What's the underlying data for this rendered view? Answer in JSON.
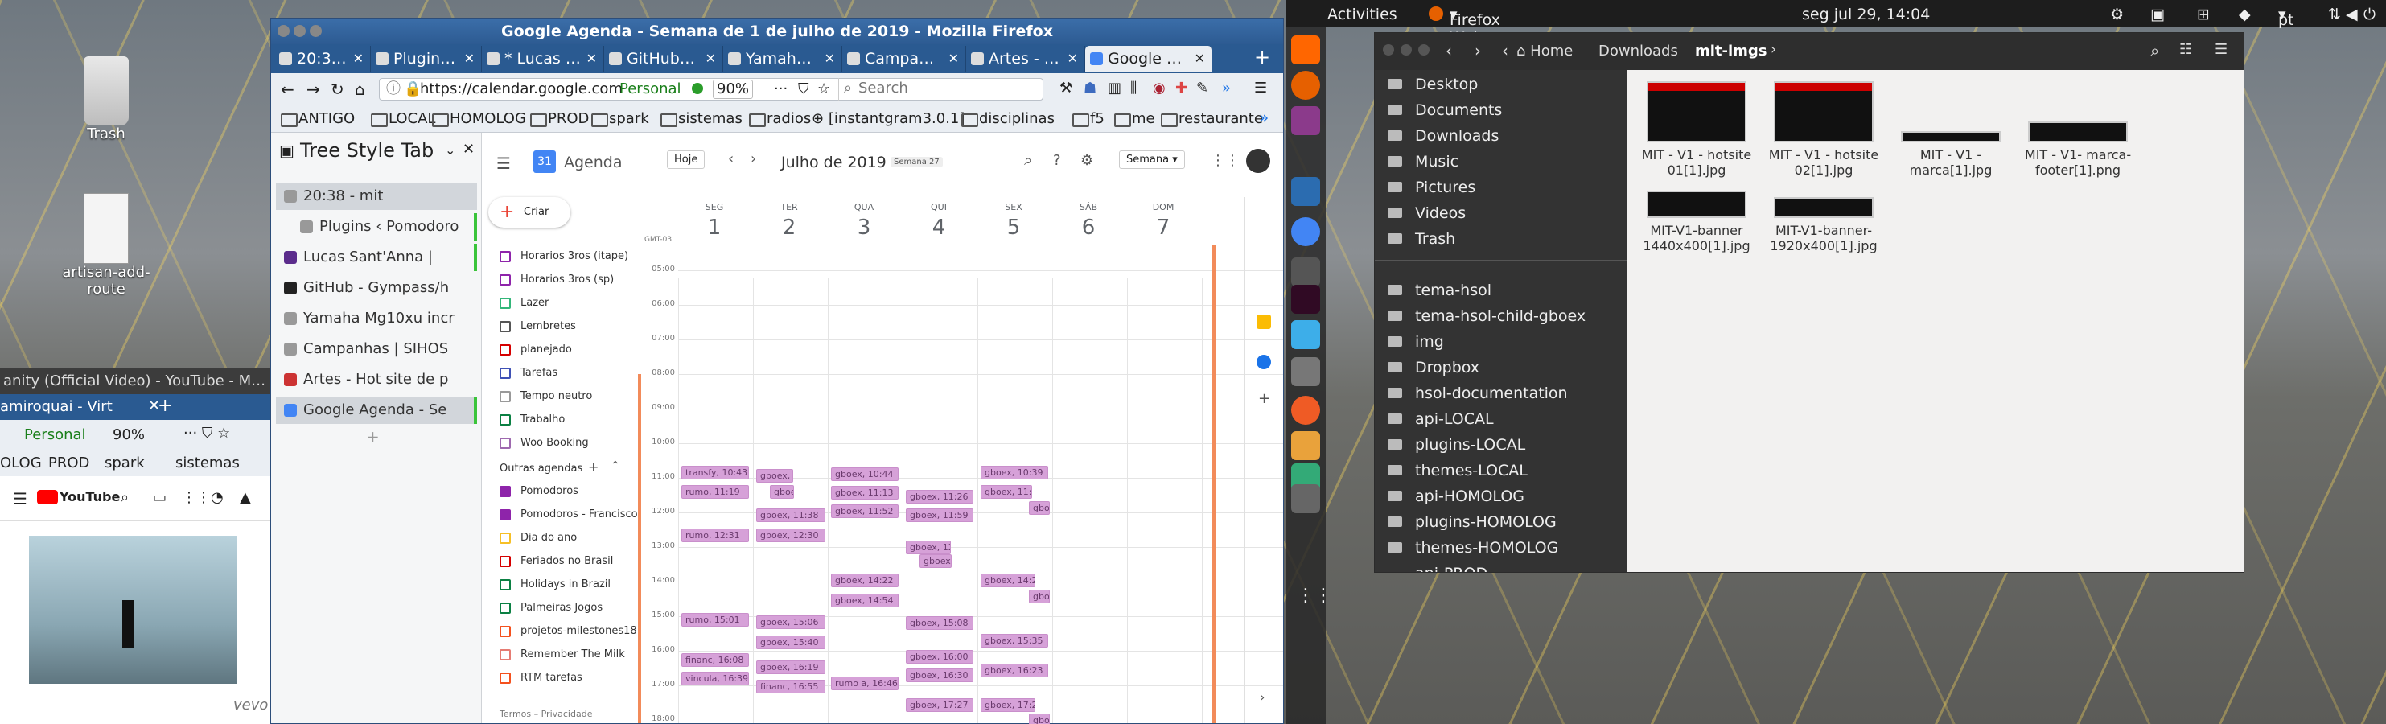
{
  "topbar": {
    "activities": "Activities",
    "app_menu": "Firefox Web Browser",
    "clock": "seg jul 29, 14:04",
    "lang": "pt"
  },
  "desktop": {
    "trash": "Trash",
    "file": "artisan-add-route"
  },
  "firefox": {
    "title": "Google Agenda - Semana de 1 de julho de 2019 - Mozilla Firefox",
    "tabs": [
      "20:38 - mit",
      "Plugins ‹ P",
      "* Lucas Sant",
      "GitHub - G",
      "Yamaha M",
      "Campanha",
      "Artes - Ho",
      "Google Ag"
    ],
    "url": "https://calendar.google.com",
    "identity": "Personal",
    "zoom": "90%",
    "search_placeholder": "Search",
    "bookmarks": [
      "ANTIGO",
      "LOCAL",
      "HOMOLOG",
      "PROD",
      "spark",
      "sistemas",
      "radios",
      "[instantgram3.0.1]",
      "disciplinas",
      "f5",
      "me",
      "restaurante"
    ],
    "sidebar": {
      "title": "Tree Style Tab",
      "tabs": [
        "20:38 - mit",
        "Plugins ‹ Pomodoro",
        "Lucas Sant'Anna |",
        "GitHub - Gympass/h",
        "Yamaha Mg10xu incr",
        "Campanhas | SIHOS",
        "Artes - Hot site de p",
        "Google Agenda - Se"
      ]
    },
    "calendar": {
      "app": "Agenda",
      "today": "Hoje",
      "month": "Julho de 2019",
      "week_badge": "Semana 27",
      "view": "Semana",
      "create": "Criar",
      "gmt": "GMT-03",
      "days": [
        {
          "n": "SEG",
          "d": "1"
        },
        {
          "n": "TER",
          "d": "2"
        },
        {
          "n": "QUA",
          "d": "3"
        },
        {
          "n": "QUI",
          "d": "4"
        },
        {
          "n": "SEX",
          "d": "5"
        },
        {
          "n": "SÁB",
          "d": "6"
        },
        {
          "n": "DOM",
          "d": "7"
        }
      ],
      "hours": [
        "05:00",
        "06:00",
        "07:00",
        "08:00",
        "09:00",
        "10:00",
        "11:00",
        "12:00",
        "13:00",
        "14:00",
        "15:00",
        "16:00",
        "17:00",
        "18:00"
      ],
      "my_cals": [
        "Horarios 3ros (itape)",
        "Horarios 3ros (sp)",
        "Lazer",
        "Lembretes",
        "planejado",
        "Tarefas",
        "Tempo neutro",
        "Trabalho",
        "Woo Booking"
      ],
      "other_title": "Outras agendas",
      "other_cals": [
        "Pomodoros",
        "Pomodoros - Francisco",
        "Dia do ano",
        "Feriados no Brasil",
        "Holidays in Brazil",
        "Palmeiras Jogos",
        "projetos-milestones18",
        "Remember The Milk",
        "RTM tarefas"
      ],
      "footer": "Termos – Privacidade",
      "events": [
        "transfy, 10:43",
        "rumo, 11:19",
        "gboex, 10:4",
        "gboex",
        "gboex, 11:38",
        "gboex, 12:30",
        "gboex, 10:44",
        "gboex, 11:13",
        "gboex, 11:52",
        "gboex, 11:26",
        "gboex, 11:59",
        "gboex, 10:39",
        "gboex, 11:1",
        "gboex",
        "rumo, 12:31",
        "gboex, 12:5",
        "gboex",
        "gboex, 14:22",
        "gboex, 14:54",
        "gboex, 14:2",
        "gboex",
        "rumo, 15:01",
        "gboex, 15:06",
        "gboex, 15:40",
        "gboex, 15:08",
        "gboex, 15:35",
        "financ, 16:08",
        "gboex, 16:19",
        "gboex, 16:00",
        "gboex, 16:23",
        "vincula, 16:39",
        "financ, 16:55",
        "rumo a, 16:46",
        "gboex, 16:30",
        "gboex, 17:27",
        "gboex, 17:2",
        "gboex"
      ]
    }
  },
  "files": {
    "home": "Home",
    "crumbs": [
      "Downloads",
      "mit-imgs"
    ],
    "places": [
      "Desktop",
      "Documents",
      "Downloads",
      "Music",
      "Pictures",
      "Videos",
      "Trash"
    ],
    "bookmarks": [
      "tema-hsol",
      "tema-hsol-child-gboex",
      "img",
      "Dropbox",
      "hsol-documentation",
      "api-LOCAL",
      "plugins-LOCAL",
      "themes-LOCAL",
      "api-HOMOLOG",
      "plugins-HOMOLOG",
      "themes-HOMOLOG",
      "api-PROD"
    ],
    "items": [
      "MIT - V1 - hotsite 01[1].jpg",
      "MIT - V1 - hotsite 02[1].jpg",
      "MIT - V1 - marca[1].jpg",
      "MIT - V1- marca-footer[1].png",
      "MIT-V1-banner 1440x400[1].jpg",
      "MIT-V1-banner-1920x400[1].jpg"
    ]
  },
  "ff2": {
    "title": "anity (Official Video) - YouTube - Mozil",
    "tab": "amiroquai - Virt",
    "identity": "Personal",
    "zoom": "90%",
    "bookmarks": [
      "OLOG",
      "PROD",
      "spark",
      "sistemas"
    ],
    "brand": "YouTube",
    "vevo": "vevo"
  }
}
